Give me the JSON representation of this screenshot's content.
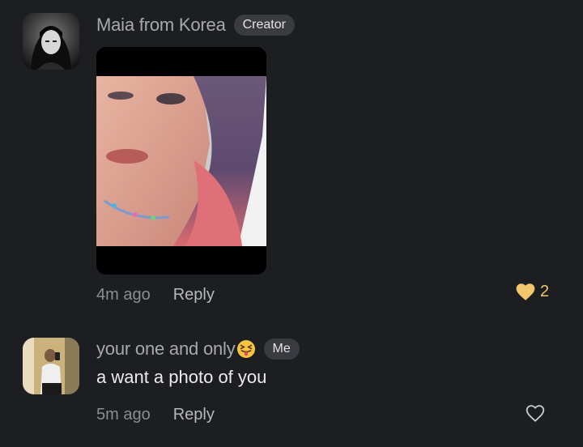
{
  "comments": [
    {
      "author": "Maia from Korea",
      "badge": "Creator",
      "has_photo": true,
      "time": "4m ago",
      "reply_label": "Reply",
      "like_count": "2",
      "liked": true,
      "colors": {
        "heart": "#f2c66b"
      }
    },
    {
      "author": "your one and only",
      "author_emoji": "squinting-face-with-tongue",
      "badge": "Me",
      "text": "a want a photo of you",
      "time": "5m ago",
      "reply_label": "Reply",
      "liked": false
    }
  ],
  "colors": {
    "background": "#1d1e22",
    "badge_bg": "#3a3b40",
    "name_text": "#a8a9ae",
    "muted_text": "#8c8d92"
  }
}
